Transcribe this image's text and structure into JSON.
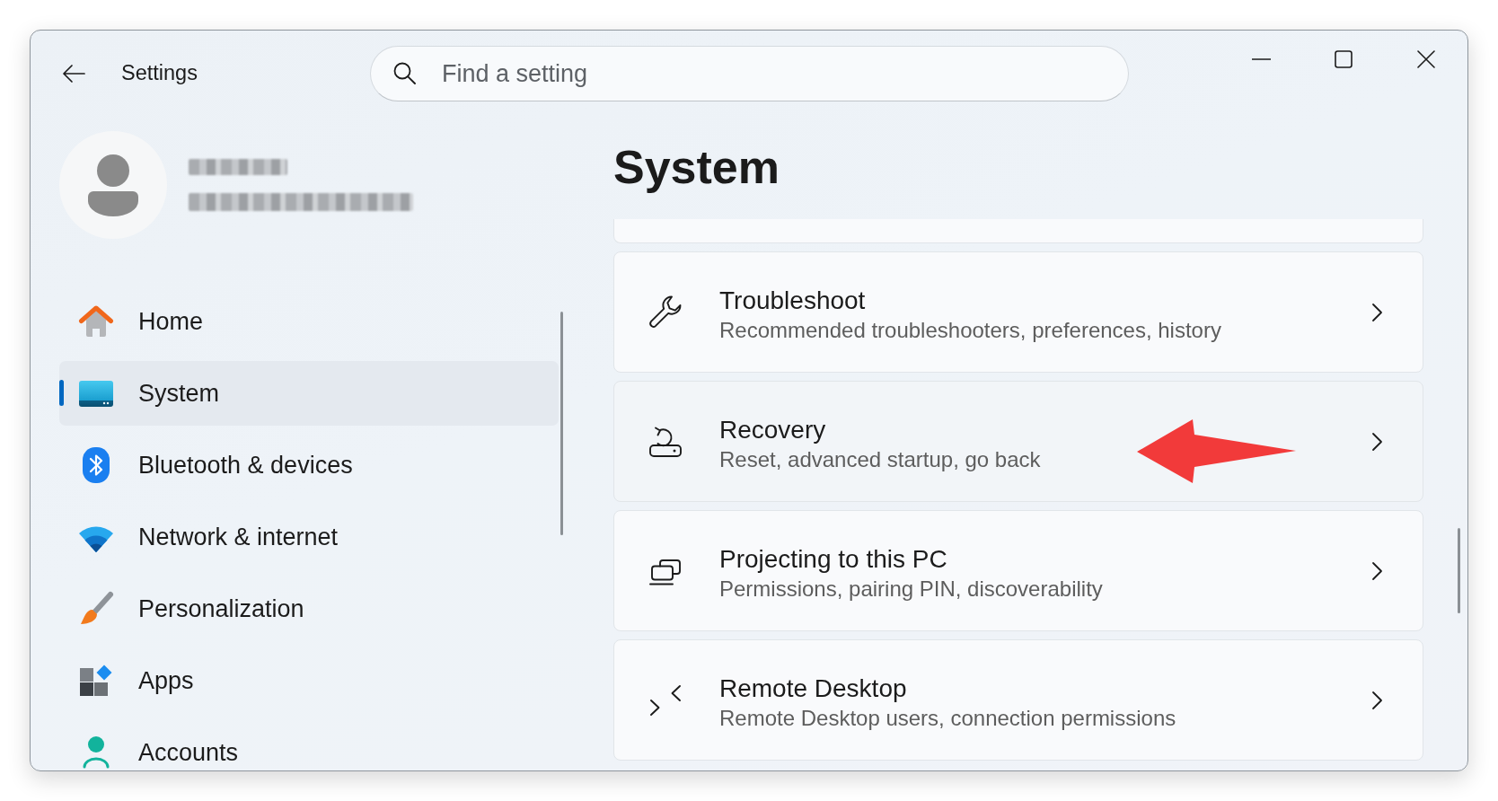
{
  "window": {
    "title": "Settings"
  },
  "search": {
    "placeholder": "Find a setting"
  },
  "sidebar": {
    "items": [
      {
        "label": "Home",
        "selected": false
      },
      {
        "label": "System",
        "selected": true
      },
      {
        "label": "Bluetooth & devices",
        "selected": false
      },
      {
        "label": "Network & internet",
        "selected": false
      },
      {
        "label": "Personalization",
        "selected": false
      },
      {
        "label": "Apps",
        "selected": false
      },
      {
        "label": "Accounts",
        "selected": false
      }
    ]
  },
  "page": {
    "title": "System",
    "cards": [
      {
        "title": "Troubleshoot",
        "subtitle": "Recommended troubleshooters, preferences, history",
        "hovered": false,
        "annotated": false
      },
      {
        "title": "Recovery",
        "subtitle": "Reset, advanced startup, go back",
        "hovered": true,
        "annotated": true
      },
      {
        "title": "Projecting to this PC",
        "subtitle": "Permissions, pairing PIN, discoverability",
        "hovered": false,
        "annotated": false
      },
      {
        "title": "Remote Desktop",
        "subtitle": "Remote Desktop users, connection permissions",
        "hovered": false,
        "annotated": false
      }
    ]
  }
}
